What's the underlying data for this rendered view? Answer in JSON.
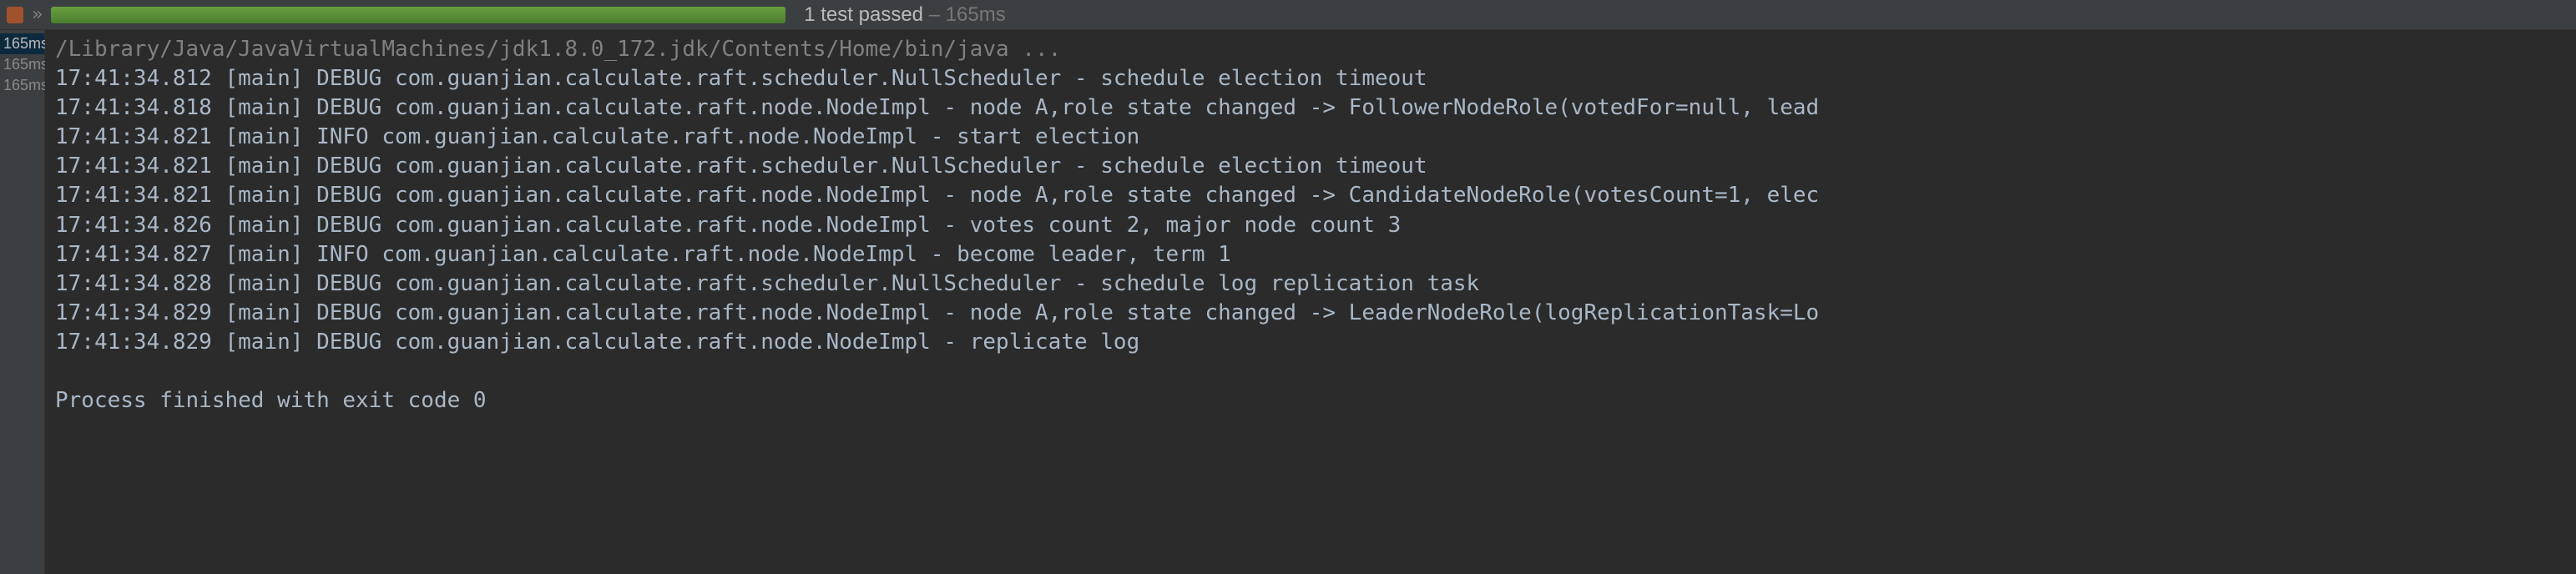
{
  "header": {
    "chevrons": "»",
    "test_status": "1 test passed",
    "test_time": "– 165ms"
  },
  "sidebar": {
    "times": [
      "165ms",
      "165ms",
      "165ms"
    ]
  },
  "console": {
    "cmd": "/Library/Java/JavaVirtualMachines/jdk1.8.0_172.jdk/Contents/Home/bin/java ...",
    "lines": [
      "17:41:34.812 [main] DEBUG com.guanjian.calculate.raft.scheduler.NullScheduler - schedule election timeout",
      "17:41:34.818 [main] DEBUG com.guanjian.calculate.raft.node.NodeImpl - node A,role state changed -> FollowerNodeRole(votedFor=null, lead",
      "17:41:34.821 [main] INFO com.guanjian.calculate.raft.node.NodeImpl - start election",
      "17:41:34.821 [main] DEBUG com.guanjian.calculate.raft.scheduler.NullScheduler - schedule election timeout",
      "17:41:34.821 [main] DEBUG com.guanjian.calculate.raft.node.NodeImpl - node A,role state changed -> CandidateNodeRole(votesCount=1, elec",
      "17:41:34.826 [main] DEBUG com.guanjian.calculate.raft.node.NodeImpl - votes count 2, major node count 3",
      "17:41:34.827 [main] INFO com.guanjian.calculate.raft.node.NodeImpl - become leader, term 1",
      "17:41:34.828 [main] DEBUG com.guanjian.calculate.raft.scheduler.NullScheduler - schedule log replication task",
      "17:41:34.829 [main] DEBUG com.guanjian.calculate.raft.node.NodeImpl - node A,role state changed -> LeaderNodeRole(logReplicationTask=Lo",
      "17:41:34.829 [main] DEBUG com.guanjian.calculate.raft.node.NodeImpl - replicate log"
    ],
    "footer": "Process finished with exit code 0"
  }
}
